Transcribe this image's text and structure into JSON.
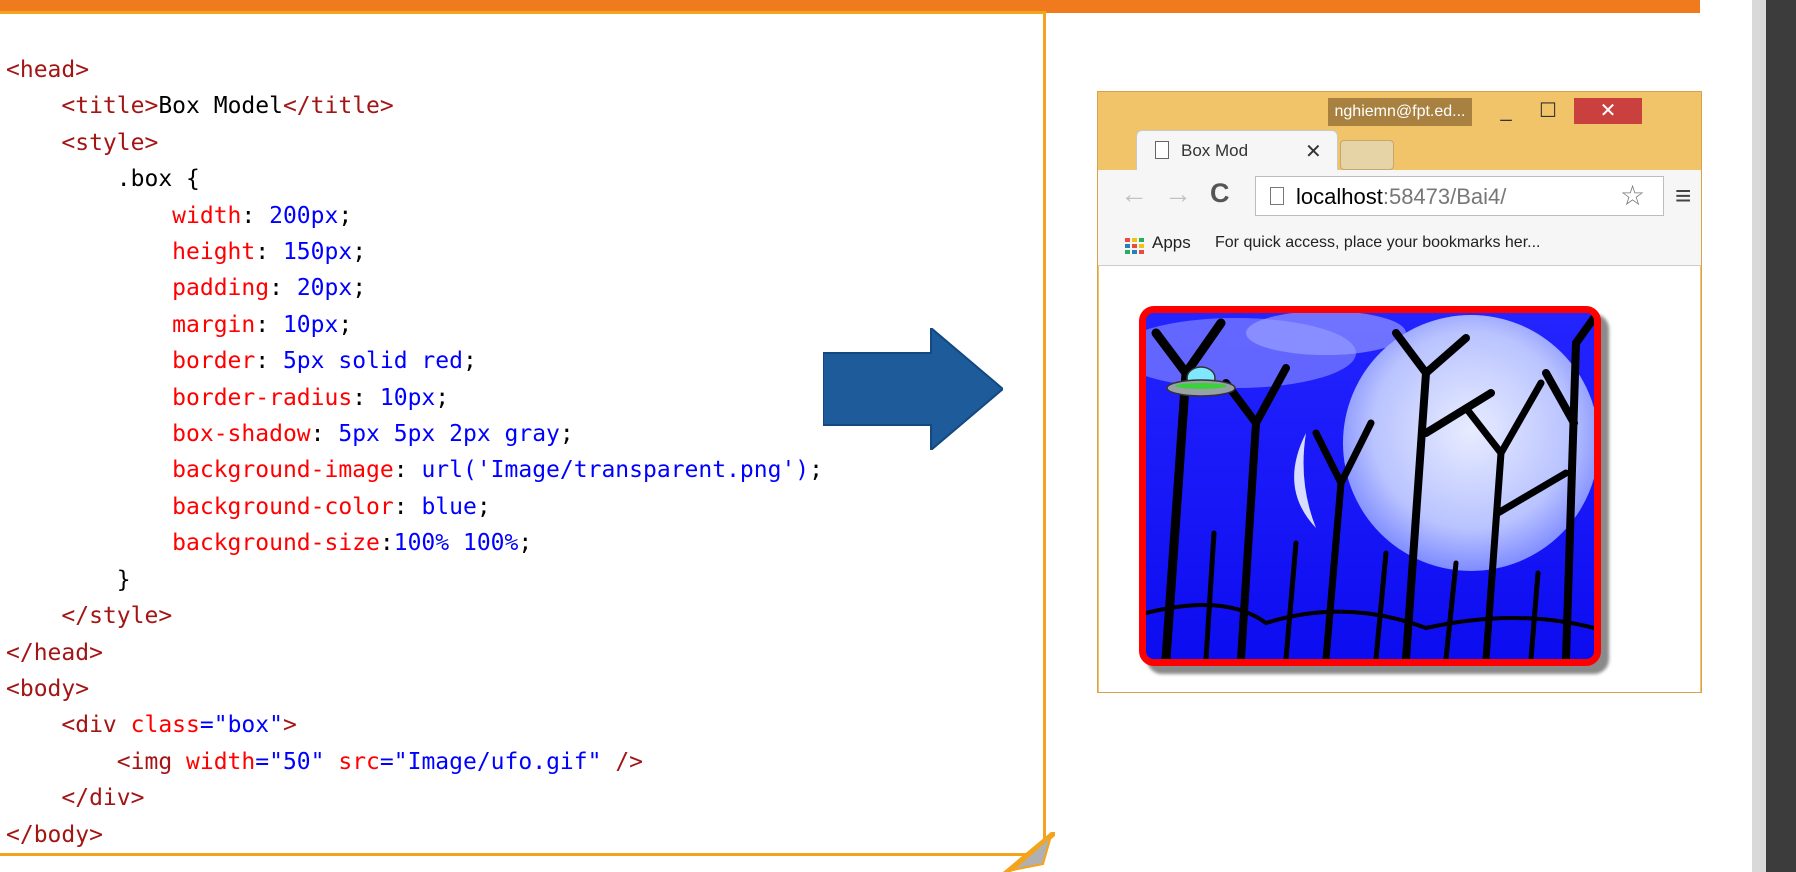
{
  "code_block": {
    "lines": [
      [
        {
          "c": "t",
          "t": "<head>"
        }
      ],
      [
        {
          "c": "k",
          "t": "    "
        },
        {
          "c": "t",
          "t": "<title>"
        },
        {
          "c": "k",
          "t": "Box Model"
        },
        {
          "c": "t",
          "t": "</title>"
        }
      ],
      [
        {
          "c": "k",
          "t": "    "
        },
        {
          "c": "t",
          "t": "<style>"
        }
      ],
      [
        {
          "c": "k",
          "t": "        .box {"
        }
      ],
      [
        {
          "c": "a",
          "t": "            width"
        },
        {
          "c": "k",
          "t": ": "
        },
        {
          "c": "b",
          "t": "200px"
        },
        {
          "c": "k",
          "t": ";"
        }
      ],
      [
        {
          "c": "a",
          "t": "            height"
        },
        {
          "c": "k",
          "t": ": "
        },
        {
          "c": "b",
          "t": "150px"
        },
        {
          "c": "k",
          "t": ";"
        }
      ],
      [
        {
          "c": "a",
          "t": "            padding"
        },
        {
          "c": "k",
          "t": ": "
        },
        {
          "c": "b",
          "t": "20px"
        },
        {
          "c": "k",
          "t": ";"
        }
      ],
      [
        {
          "c": "a",
          "t": "            margin"
        },
        {
          "c": "k",
          "t": ": "
        },
        {
          "c": "b",
          "t": "10px"
        },
        {
          "c": "k",
          "t": ";"
        }
      ],
      [
        {
          "c": "a",
          "t": "            border"
        },
        {
          "c": "k",
          "t": ": "
        },
        {
          "c": "b",
          "t": "5px solid red"
        },
        {
          "c": "k",
          "t": ";"
        }
      ],
      [
        {
          "c": "a",
          "t": "            border-radius"
        },
        {
          "c": "k",
          "t": ": "
        },
        {
          "c": "b",
          "t": "10px"
        },
        {
          "c": "k",
          "t": ";"
        }
      ],
      [
        {
          "c": "a",
          "t": "            box-shadow"
        },
        {
          "c": "k",
          "t": ": "
        },
        {
          "c": "b",
          "t": "5px 5px 2px gray"
        },
        {
          "c": "k",
          "t": ";"
        }
      ],
      [
        {
          "c": "a",
          "t": "            background-image"
        },
        {
          "c": "k",
          "t": ": "
        },
        {
          "c": "b",
          "t": "url('Image/transparent.png')"
        },
        {
          "c": "k",
          "t": ";"
        }
      ],
      [
        {
          "c": "a",
          "t": "            background-color"
        },
        {
          "c": "k",
          "t": ": "
        },
        {
          "c": "b",
          "t": "blue"
        },
        {
          "c": "k",
          "t": ";"
        }
      ],
      [
        {
          "c": "a",
          "t": "            background-size"
        },
        {
          "c": "k",
          "t": ":"
        },
        {
          "c": "b",
          "t": "100% 100%"
        },
        {
          "c": "k",
          "t": ";"
        }
      ],
      [
        {
          "c": "k",
          "t": "        }"
        }
      ],
      [
        {
          "c": "k",
          "t": "    "
        },
        {
          "c": "t",
          "t": "</style>"
        }
      ],
      [
        {
          "c": "t",
          "t": "</head>"
        }
      ],
      [
        {
          "c": "t",
          "t": "<body>"
        }
      ],
      [
        {
          "c": "k",
          "t": "    "
        },
        {
          "c": "t",
          "t": "<div"
        },
        {
          "c": "a",
          "t": " class"
        },
        {
          "c": "b",
          "t": "=\"box\""
        },
        {
          "c": "t",
          "t": ">"
        }
      ],
      [
        {
          "c": "k",
          "t": "        "
        },
        {
          "c": "t",
          "t": "<img"
        },
        {
          "c": "a",
          "t": " width"
        },
        {
          "c": "b",
          "t": "=\"50\""
        },
        {
          "c": "a",
          "t": " src"
        },
        {
          "c": "b",
          "t": "=\"Image/ufo.gif\""
        },
        {
          "c": "t",
          "t": " />"
        }
      ],
      [
        {
          "c": "k",
          "t": "    "
        },
        {
          "c": "t",
          "t": "</div>"
        }
      ],
      [
        {
          "c": "t",
          "t": "</body>"
        }
      ]
    ]
  },
  "browser": {
    "user_label": "nghiemn@fpt.ed...",
    "minimize_glyph": "_",
    "maximize_glyph": "☐",
    "close_glyph": "✕",
    "tab_title": "Box Mod",
    "tab_close_glyph": "✕",
    "back_glyph": "←",
    "forward_glyph": "→",
    "reload_glyph": "C",
    "url_host": "localhost",
    "url_rest": ":58473/Bai4/",
    "star_glyph": "☆",
    "menu_glyph": "≡",
    "apps_label": "Apps",
    "bookmarks_hint": "For quick access, place your bookmarks her..."
  },
  "colors": {
    "accent_orange": "#f07a1e",
    "card_border": "#f4a41c",
    "arrow_fill": "#1d5b9a",
    "box_border": "#ff0000",
    "box_background": "#1414ff"
  },
  "icons": [
    "document-icon",
    "arrow-right-icon",
    "star-icon",
    "menu-icon",
    "apps-grid-icon",
    "ufo-icon"
  ]
}
